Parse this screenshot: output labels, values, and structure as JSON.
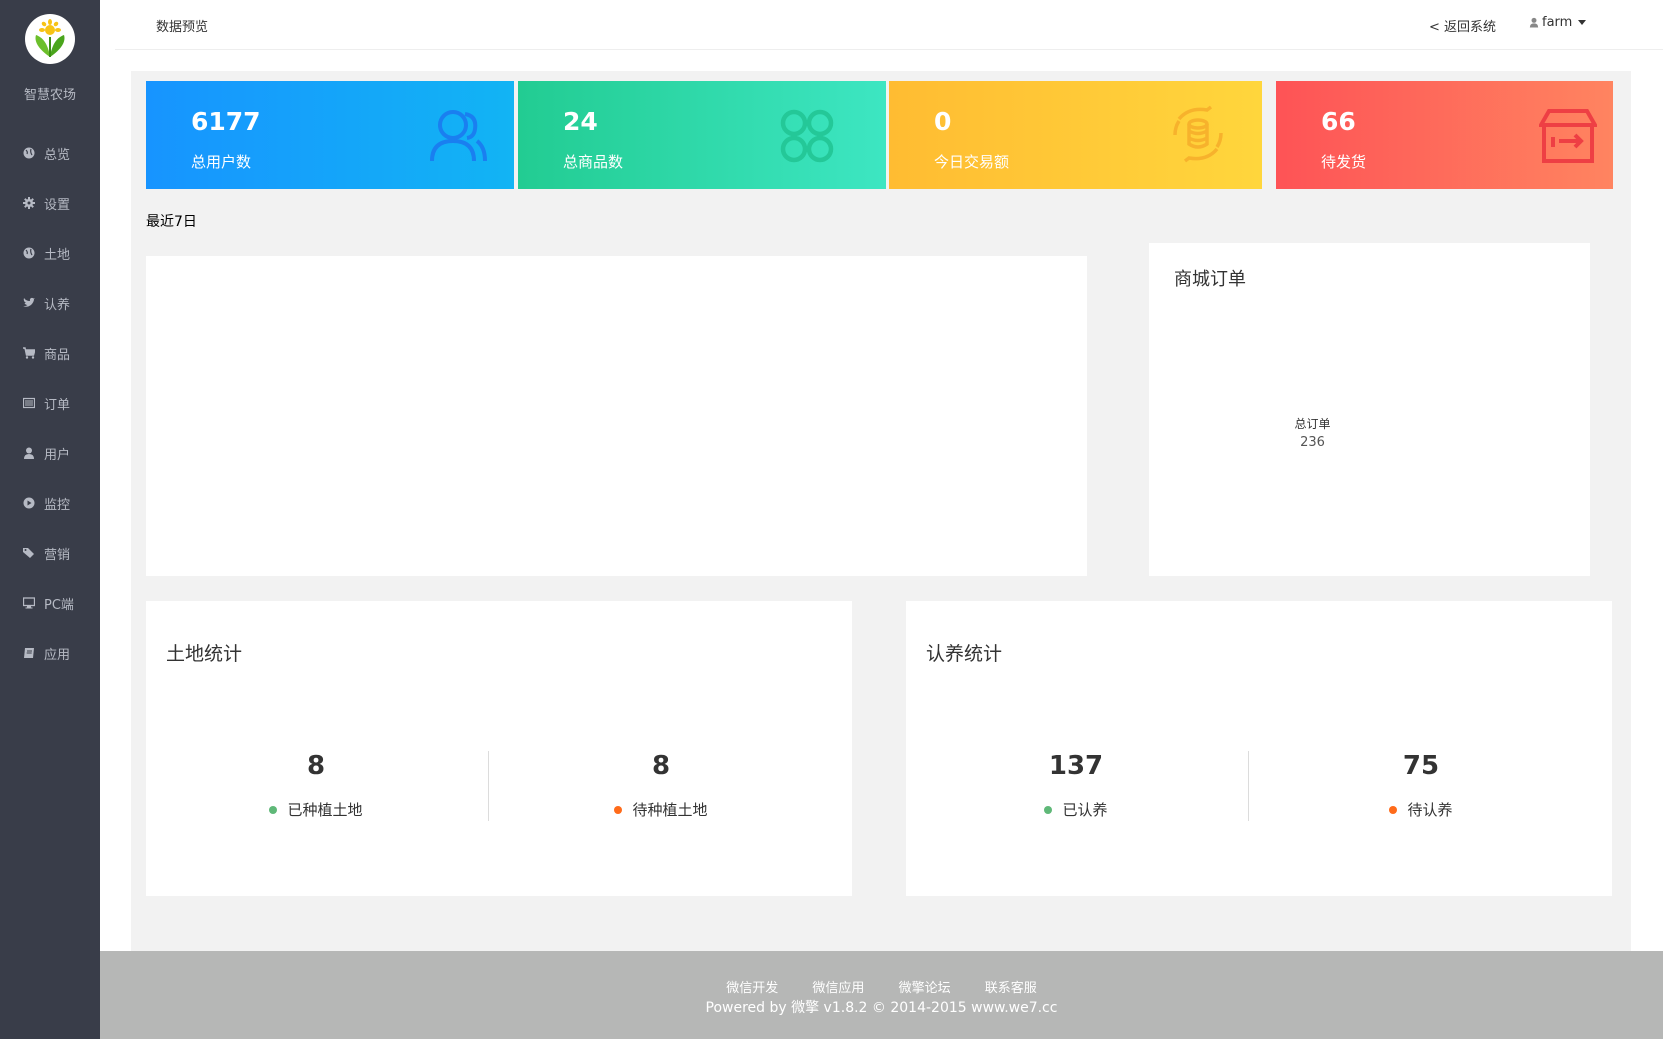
{
  "sidebar": {
    "brand": "智慧农场",
    "items": [
      {
        "label": "总览",
        "icon": "globe-icon"
      },
      {
        "label": "设置",
        "icon": "gear-icon"
      },
      {
        "label": "土地",
        "icon": "globe-icon"
      },
      {
        "label": "认养",
        "icon": "twitter-bird-icon"
      },
      {
        "label": "商品",
        "icon": "cart-icon"
      },
      {
        "label": "订单",
        "icon": "list-icon"
      },
      {
        "label": "用户",
        "icon": "user-icon"
      },
      {
        "label": "监控",
        "icon": "play-circle-icon"
      },
      {
        "label": "营销",
        "icon": "tags-icon"
      },
      {
        "label": "PC端",
        "icon": "monitor-icon"
      },
      {
        "label": "应用",
        "icon": "book-icon"
      }
    ]
  },
  "header": {
    "breadcrumb": "数据预览",
    "back_link": "< 返回系统",
    "username": "farm"
  },
  "stats": [
    {
      "value": "6177",
      "label": "总用户数",
      "icon": "users-icon",
      "color": "#1794ff"
    },
    {
      "value": "24",
      "label": "总商品数",
      "icon": "clover-grid-icon",
      "color": "#22cc92"
    },
    {
      "value": "0",
      "label": "今日交易额",
      "icon": "coin-exchange-icon",
      "color": "#ffbc32"
    },
    {
      "value": "66",
      "label": "待发货",
      "icon": "box-arrow-icon",
      "color": "#fe5356"
    }
  ],
  "recent_label": "最近7日",
  "orders": {
    "title": "商城订单",
    "total_label": "总订单",
    "total_value": "236"
  },
  "land": {
    "title": "土地统计",
    "planted_value": "8",
    "planted_label": "已种植土地",
    "pending_value": "8",
    "pending_label": "待种植土地"
  },
  "adoption": {
    "title": "认养统计",
    "adopted_value": "137",
    "adopted_label": "已认养",
    "pending_value": "75",
    "pending_label": "待认养"
  },
  "colors": {
    "green_dot": "#5fb878",
    "orange_dot": "#ff6b1a"
  },
  "footer": {
    "links": [
      "微信开发",
      "微信应用",
      "微擎论坛",
      "联系客服"
    ],
    "powered": "Powered by 微擎 v1.8.2 © 2014-2015 www.we7.cc"
  }
}
